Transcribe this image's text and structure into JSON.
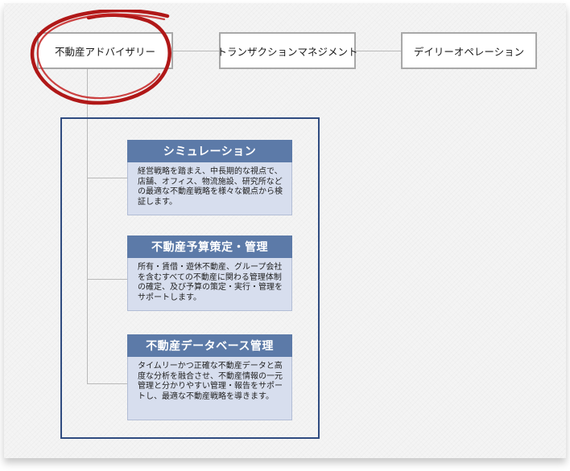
{
  "top_nav": [
    {
      "label": "不動産アドバイザリー"
    },
    {
      "label": "トランザクションマネジメント"
    },
    {
      "label": "デイリーオペレーション"
    }
  ],
  "services": [
    {
      "title": "シミュレーション",
      "description": "経営戦略を踏まえ、中長期的な視点で、店舗、オフィス、物流施設、研究所などの最適な不動産戦略を様々な観点から検証します。"
    },
    {
      "title": "不動産予算策定・管理",
      "description": "所有・賃借・遊休不動産、グループ会社を含むすべての不動産に関わる管理体制の確定、及び予算の策定・実行・管理をサポートします。"
    },
    {
      "title": "不動産データベース管理",
      "description": "タイムリーかつ正確な不動産データと高度な分析を融合させ、不動産情報の一元管理と分かりやすい管理・報告をサポートし、最適な不動産戦略を導きます。"
    }
  ],
  "colors": {
    "panel_border": "#2f4b80",
    "item_header": "#5c7aa8",
    "item_body": "#d7deee",
    "highlight_circle": "#b01818"
  },
  "icons": {
    "highlight": "red-circle-mark"
  }
}
